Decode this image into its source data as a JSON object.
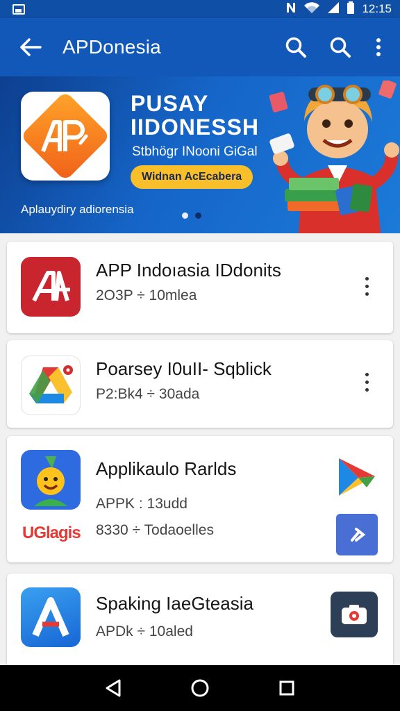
{
  "status_bar": {
    "time": "12:15"
  },
  "app_bar": {
    "title": "APDonesia"
  },
  "banner": {
    "title_line1": "PUSAY",
    "title_line2": "IIDONESSH",
    "subtitle": "Stbhögr INooni GiGal",
    "cta_label": "Widnan AcEcabera",
    "caption": "Aplauydiry adiorensia",
    "dots_total": 2,
    "dots_active": 1
  },
  "apps": [
    {
      "name": "APP Indoıasia IDdonits",
      "meta": "2O3P ÷ 10mlea",
      "icon": "red-ap-logo-icon"
    },
    {
      "name": "Poarsey I0uII- Sqblick",
      "meta": "P2:Bk4 ÷ 30ada",
      "icon": "drive-triangle-icon"
    },
    {
      "name": "Applikaulo Rarlds",
      "meta": "APPK : 13udd",
      "extra_label": "UGlagis",
      "extra_meta": "8330 ÷ Todaoelles",
      "icon": "smiley-character-icon"
    },
    {
      "name": "Spaking IaeGteasia",
      "meta": "APDk ÷ 10aled",
      "icon": "letter-a-icon"
    }
  ],
  "colors": {
    "app_bar": "#1258b8",
    "status_bar": "#0f4fa6",
    "cta": "#f9bf2b",
    "brand_orange": "#f06018",
    "brand_red": "#c8252f"
  }
}
